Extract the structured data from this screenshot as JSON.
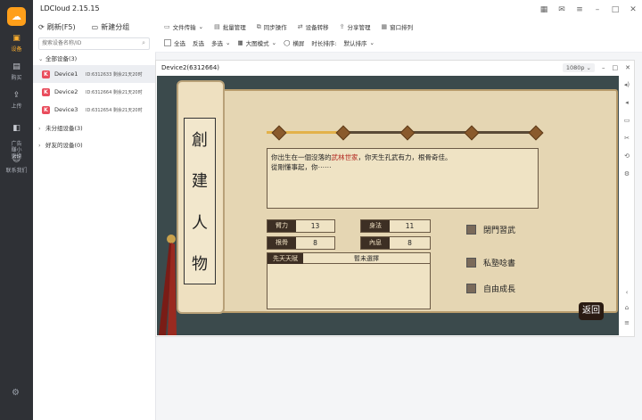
{
  "app": {
    "title": "LDCloud 2.15.15"
  },
  "rail": {
    "items": [
      {
        "label": "设备",
        "icon": "devices-icon",
        "active": true
      },
      {
        "label": "购买",
        "icon": "shop-icon"
      },
      {
        "label": "上传",
        "icon": "upload-icon"
      },
      {
        "label": "广告\n赚小\n更换",
        "icon": "ad-icon"
      },
      {
        "label": "联系我们",
        "icon": "contact-icon"
      }
    ]
  },
  "devpanel": {
    "refresh": "刷新(F5)",
    "new_group": "新建分组",
    "search_placeholder": "搜索设备名称/ID",
    "groups": {
      "all": "全部设备(3)",
      "ungrouped": "未分组设备(3)",
      "friends": "好友的设备(0)"
    },
    "devices": [
      {
        "name": "Device1",
        "info": "ID:6312633 剩余21天20时"
      },
      {
        "name": "Device2",
        "info": "ID:6312664 剩余21天20时"
      },
      {
        "name": "Device3",
        "info": "ID:6312654 剩余21天20时"
      }
    ]
  },
  "toolbar1": {
    "file_transfer": "文件传输",
    "batch_manage": "批量管理",
    "sync": "同步操作",
    "transfer": "设备转移",
    "share": "分享管理",
    "window_arrange": "窗口排列"
  },
  "toolbar2": {
    "select_all": "全选",
    "invert": "反选",
    "multi_select": "多选",
    "large_mode": "大图模式",
    "landscape": "横屏",
    "sort_label": "时长排序:",
    "sort_value": "默认排序"
  },
  "devwin": {
    "title": "Device2(6312664)",
    "resolution": "1080p"
  },
  "game": {
    "scroll_title": [
      "創",
      "建",
      "人",
      "物"
    ],
    "story_pre": "你出生在一個沒落的",
    "story_hl": "武林世家",
    "story_post": "，你天生孔武有力，根骨奇佳。",
    "story_line2": "從剛懂事起，你⋯⋯",
    "stats": [
      {
        "label": "臂力",
        "value": "13"
      },
      {
        "label": "身法",
        "value": "11"
      },
      {
        "label": "根骨",
        "value": "8"
      },
      {
        "label": "內息",
        "value": "8"
      }
    ],
    "innate_label": "先天天賦",
    "innate_value": "暫未選擇",
    "options": [
      "閉門習武",
      "私塾唸書",
      "自由成長"
    ],
    "back": "返回",
    "progress": 0.28
  }
}
